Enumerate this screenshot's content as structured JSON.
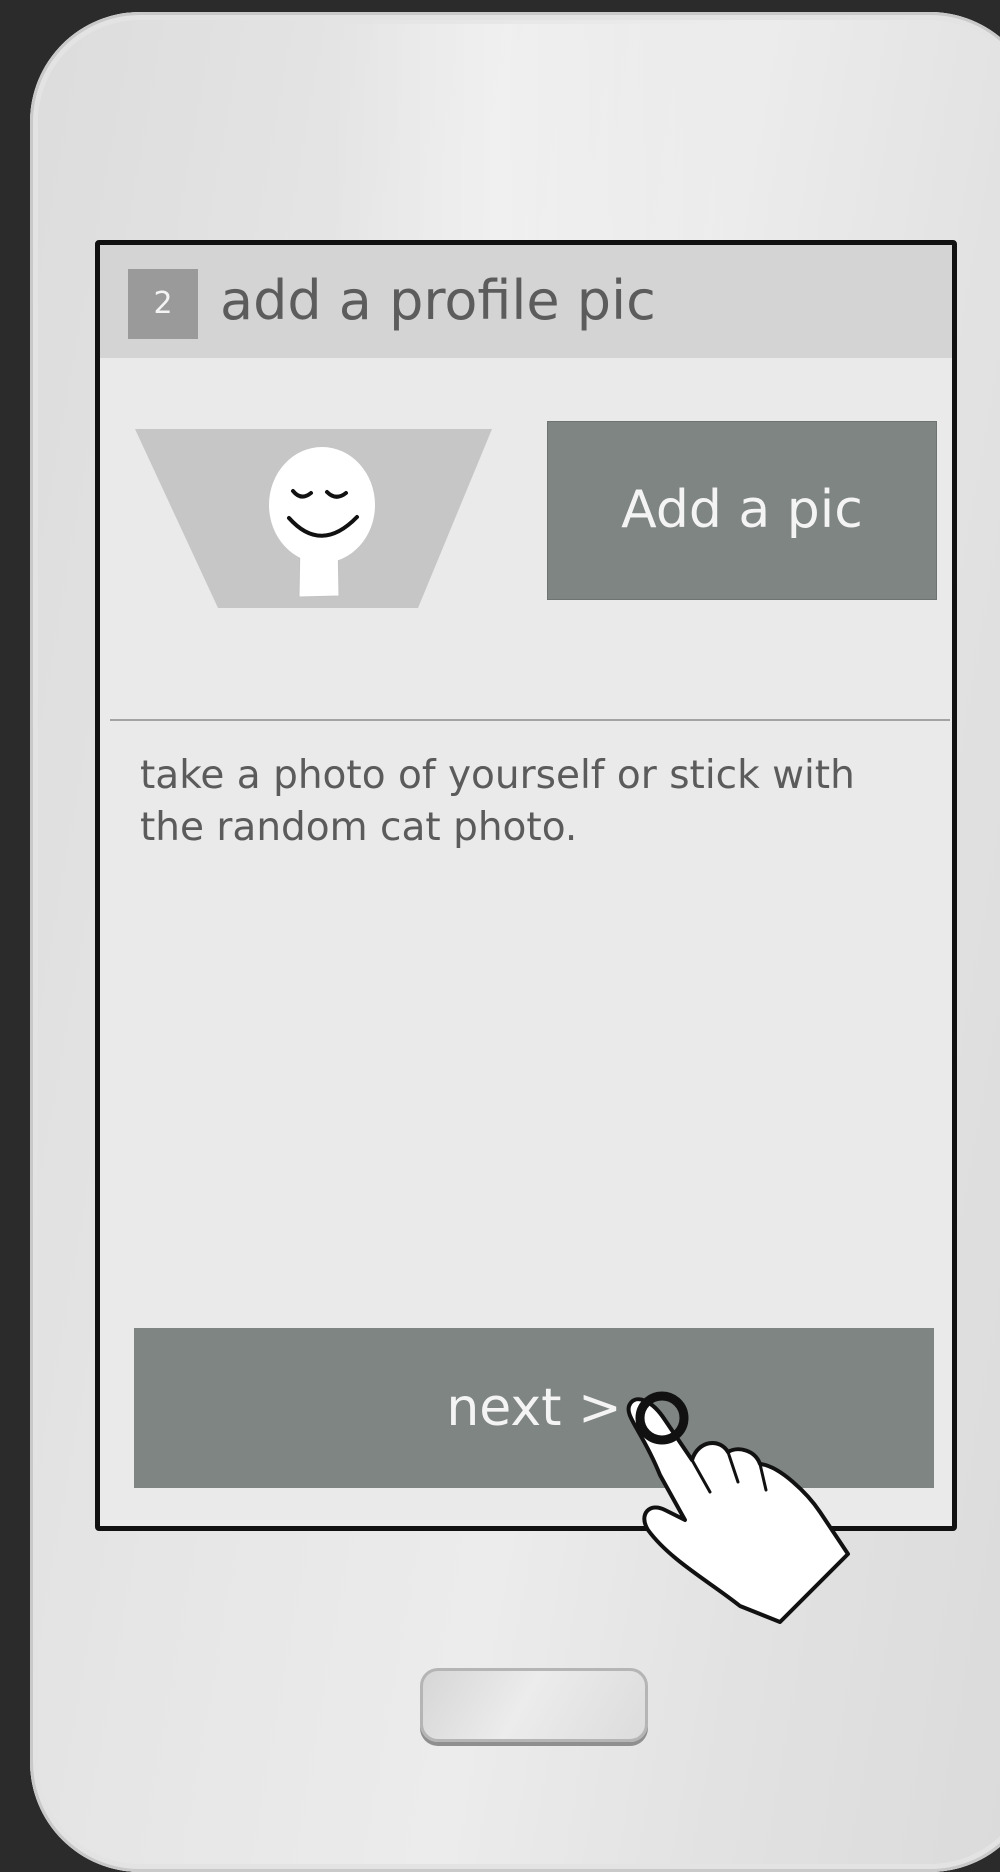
{
  "onboarding": {
    "step_number": "2",
    "title": "add a profile pic",
    "add_pic_label": "Add a pic",
    "description": "take a photo of yourself or stick with the random cat photo.",
    "next_label": "next >"
  },
  "icons": {
    "avatar": "avatar-placeholder-icon",
    "hand": "tap-gesture-icon"
  },
  "colors": {
    "button": "#7f8583",
    "header": "#d4d4d4",
    "screen": "#eaeaea",
    "badge": "#9a9a9a"
  }
}
